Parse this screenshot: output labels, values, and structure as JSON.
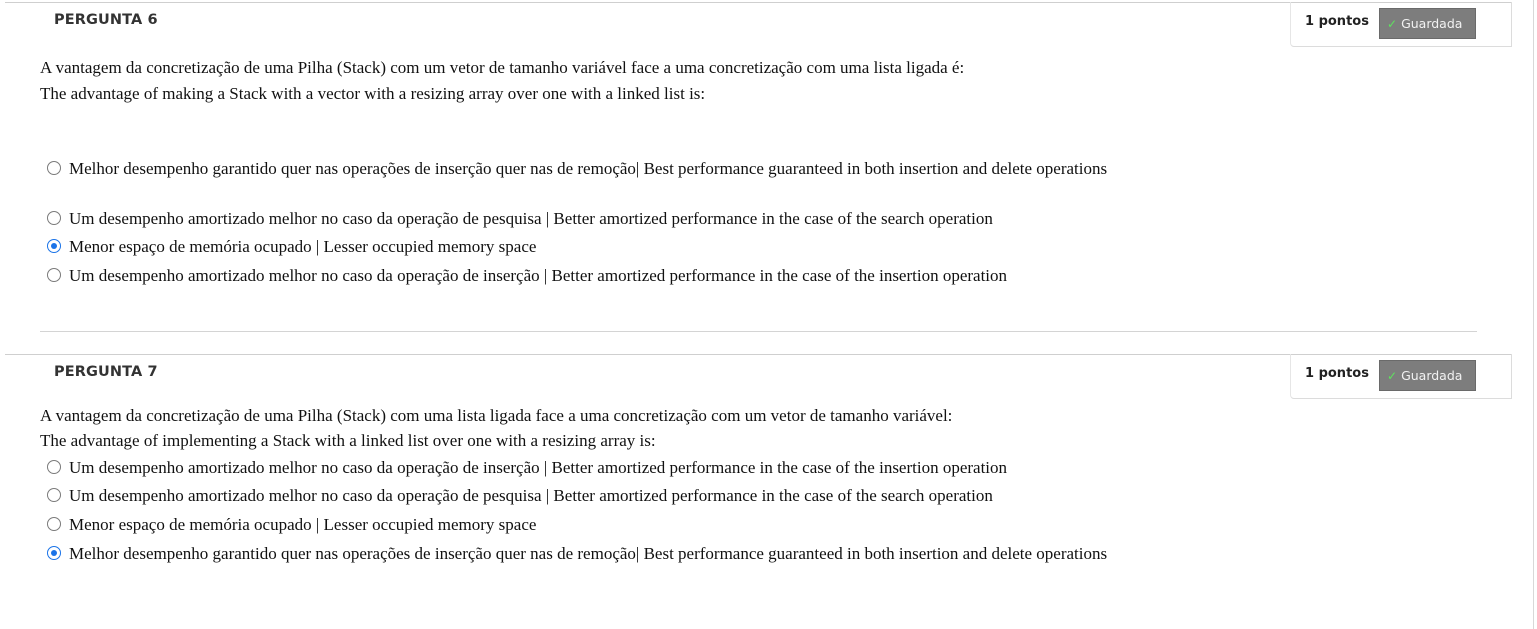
{
  "questions": [
    {
      "title": "PERGUNTA 6",
      "points": "1 pontos",
      "status": "Guardada",
      "text_pt": "A vantagem da concretização de uma Pilha (Stack) com um vetor de tamanho variável face a uma concretização com uma lista ligada é:",
      "text_en": "The advantage of making a Stack with a vector with a resizing array over one with a linked list is:",
      "options": [
        {
          "label": "Melhor desempenho garantido quer nas operações de inserção quer nas de remoção|   Best performance guaranteed in both insertion and delete operations",
          "selected": false
        },
        {
          "label": "Um desempenho amortizado melhor no caso da operação de pesquisa   |   Better amortized performance in the case of the search operation",
          "selected": false
        },
        {
          "label": "Menor espaço de memória ocupado   |   Lesser occupied memory space",
          "selected": true
        },
        {
          "label": "Um desempenho amortizado melhor no caso da operação de inserção   |   Better amortized performance in the case of the insertion operation",
          "selected": false
        }
      ]
    },
    {
      "title": "PERGUNTA 7",
      "points": "1 pontos",
      "status": "Guardada",
      "text_pt": "A vantagem da concretização de uma Pilha (Stack) com uma lista ligada face a uma concretização com um vetor de tamanho variável:",
      "text_en": "The advantage of implementing a Stack with a linked list over one with a resizing array is:",
      "options": [
        {
          "label": "Um desempenho amortizado melhor no caso da operação de inserção   |   Better amortized performance in the case of the insertion operation",
          "selected": false
        },
        {
          "label": "Um desempenho amortizado melhor no caso da operação de pesquisa   |   Better amortized performance in the case of the search operation",
          "selected": false
        },
        {
          "label": "Menor espaço de memória ocupado   |   Lesser occupied memory space",
          "selected": false
        },
        {
          "label": "Melhor desempenho garantido quer nas operações de inserção quer nas de remoção|   Best performance guaranteed in both insertion and delete operations",
          "selected": true
        }
      ]
    }
  ],
  "colors": {
    "accent": "#1a73e8",
    "badge_bg": "#7d7d7d",
    "check": "#5ee35e"
  },
  "icons": {
    "saved": "check-icon",
    "radio": "radio-icon"
  }
}
